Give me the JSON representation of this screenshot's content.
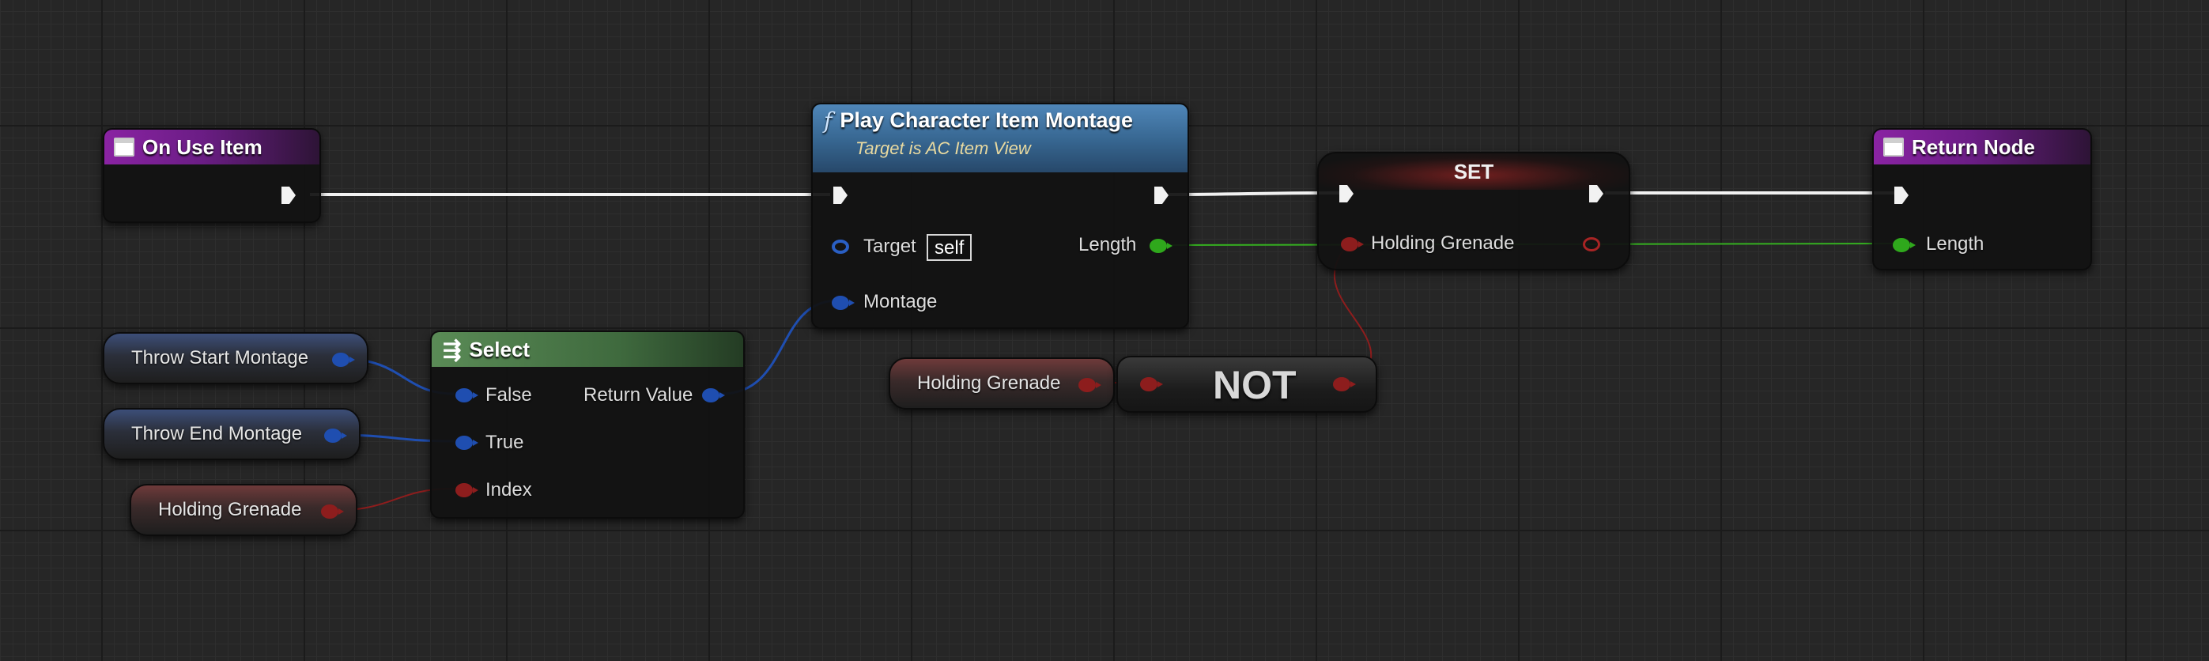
{
  "nodes": {
    "on_use_item": {
      "title": "On Use Item"
    },
    "play_montage": {
      "title": "Play Character Item Montage",
      "subtitle": "Target is AC Item View",
      "target_label": "Target",
      "target_value": "self",
      "length_label": "Length",
      "montage_label": "Montage"
    },
    "set_node": {
      "title": "SET",
      "var_label": "Holding Grenade"
    },
    "return_node": {
      "title": "Return Node",
      "length_label": "Length"
    },
    "select": {
      "title": "Select",
      "false_label": "False",
      "true_label": "True",
      "index_label": "Index",
      "return_label": "Return Value"
    },
    "not_node": {
      "title": "NOT"
    }
  },
  "variables": {
    "throw_start": "Throw Start Montage",
    "throw_end": "Throw End Montage",
    "holding_grenade_select": "Holding Grenade",
    "holding_grenade_not": "Holding Grenade"
  },
  "colors": {
    "exec_wire": "#f2f2f2",
    "float_wire": "#35b020",
    "bool_wire": "#8d1d1d",
    "object_wire": "#1f4eb0",
    "event_header": "#8a23a3",
    "function_header": "#4f86b8",
    "pure_header": "#5a8b56"
  }
}
